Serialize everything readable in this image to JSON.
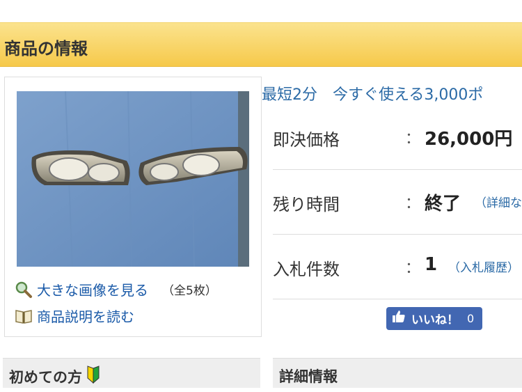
{
  "section": {
    "title": "商品の情報"
  },
  "image_panel": {
    "view_large_label": "大きな画像を見る",
    "image_count": "（全5枚）",
    "description_label": "商品説明を読む"
  },
  "promo": {
    "text": "最短2分　今すぐ使える3,000ポ"
  },
  "info": {
    "buy_now": {
      "label": "即決価格",
      "colon": "：",
      "value": "26,000円"
    },
    "time_left": {
      "label": "残り時間",
      "colon": "：",
      "value": "終了",
      "extra": "（詳細な"
    },
    "bids": {
      "label": "入札件数",
      "colon": "：",
      "value": "1",
      "extra": "（入札履歴）"
    }
  },
  "like_button": {
    "label": "いいね！",
    "count": "0"
  },
  "bottom": {
    "beginners_title": "初めての方",
    "details_title": "詳細情報"
  },
  "colors": {
    "header_gradient_top": "#fbe38e",
    "header_gradient_bottom": "#f6c94a",
    "link": "#1a5aa8",
    "facebook_blue": "#4267b2"
  }
}
